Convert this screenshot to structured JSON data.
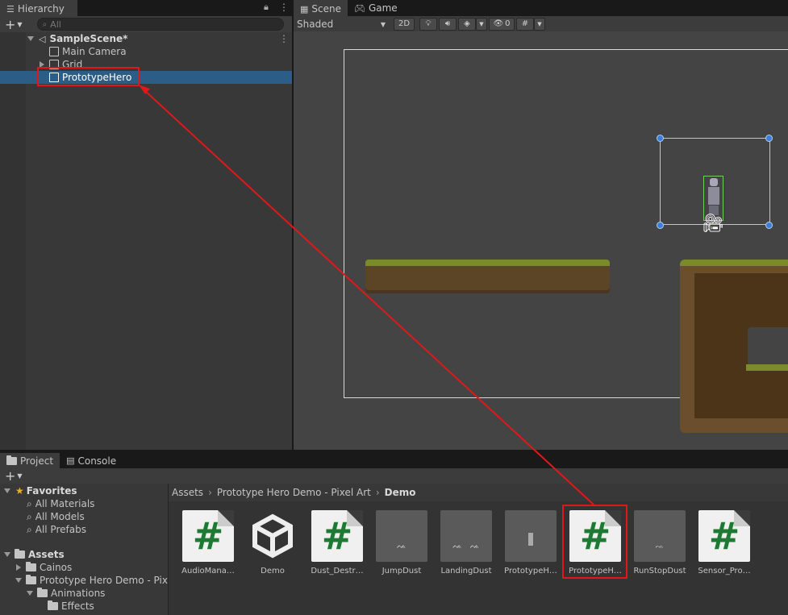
{
  "hierarchy": {
    "tab_label": "Hierarchy",
    "search_placeholder": "All",
    "scene_name": "SampleScene*",
    "items": [
      "Main Camera",
      "Grid",
      "PrototypeHero"
    ]
  },
  "scene_view": {
    "tabs": [
      "Scene",
      "Game"
    ],
    "shading_mode": "Shaded",
    "mode_2d_label": "2D",
    "hidden_count": "0"
  },
  "bottom_tabs": [
    "Project",
    "Console"
  ],
  "project": {
    "favorites_label": "Favorites",
    "favorites": [
      "All Materials",
      "All Models",
      "All Prefabs"
    ],
    "assets_label": "Assets",
    "tree": [
      "Cainos",
      "Prototype Hero Demo - Pixel",
      "Animations",
      "Effects"
    ],
    "breadcrumb": [
      "Assets",
      "Prototype Hero Demo - Pixel Art",
      "Demo"
    ],
    "assets": [
      {
        "name": "AudioMana…",
        "kind": "script"
      },
      {
        "name": "Demo",
        "kind": "unity"
      },
      {
        "name": "Dust_Destr…",
        "kind": "script"
      },
      {
        "name": "JumpDust",
        "kind": "sprite"
      },
      {
        "name": "LandingDust",
        "kind": "sprite"
      },
      {
        "name": "PrototypeH…",
        "kind": "sprite"
      },
      {
        "name": "PrototypeH…",
        "kind": "script"
      },
      {
        "name": "RunStopDust",
        "kind": "sprite"
      },
      {
        "name": "Sensor_Pro…",
        "kind": "script"
      }
    ]
  },
  "colors": {
    "highlight_box": "#e01818",
    "selection": "#2c5d87",
    "script_hash": "#1e7a33",
    "panel": "#383838",
    "scene_bg": "#444444"
  }
}
